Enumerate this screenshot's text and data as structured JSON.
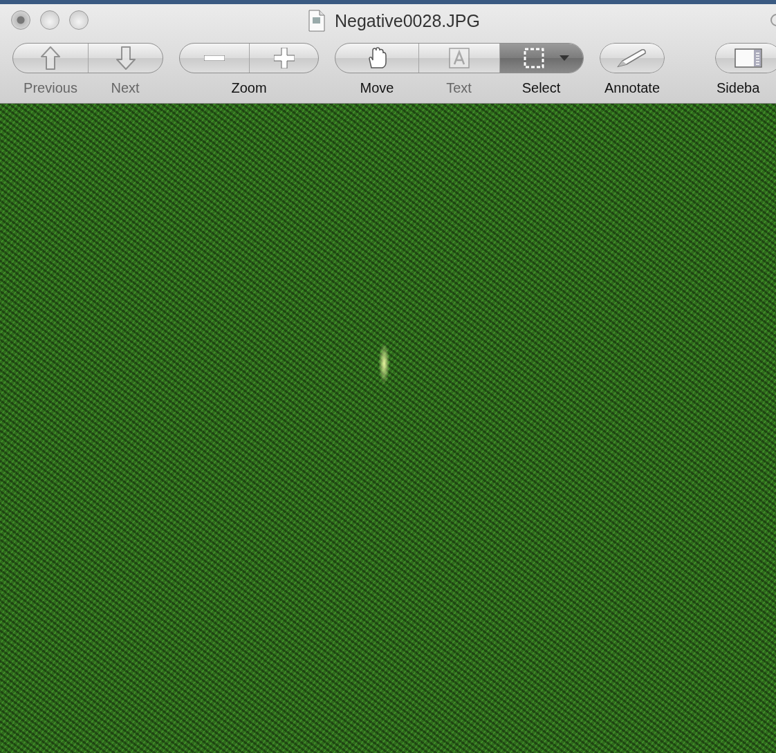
{
  "window": {
    "title": "Negative0028.JPG"
  },
  "toolbar": {
    "groups": [
      {
        "kind": "nav",
        "segments": [
          {
            "kind": "up-arrow",
            "label": "Previous",
            "disabled": true
          },
          {
            "kind": "down-arrow",
            "label": "Next",
            "disabled": true
          }
        ]
      },
      {
        "kind": "zoom",
        "label": "Zoom",
        "segments": [
          {
            "kind": "minus"
          },
          {
            "kind": "plus"
          }
        ]
      },
      {
        "kind": "tools",
        "segments": [
          {
            "kind": "hand",
            "label": "Move",
            "disabled": false,
            "selected": false
          },
          {
            "kind": "text",
            "label": "Text",
            "disabled": true,
            "selected": false
          },
          {
            "kind": "select",
            "label": "Select",
            "disabled": false,
            "selected": true
          }
        ]
      },
      {
        "kind": "single",
        "label": "Annotate",
        "segments": [
          {
            "kind": "pencil"
          }
        ]
      },
      {
        "kind": "single",
        "label": "Sideba",
        "segments": [
          {
            "kind": "sidebar"
          }
        ]
      }
    ]
  },
  "content": {
    "kind": "photo"
  }
}
